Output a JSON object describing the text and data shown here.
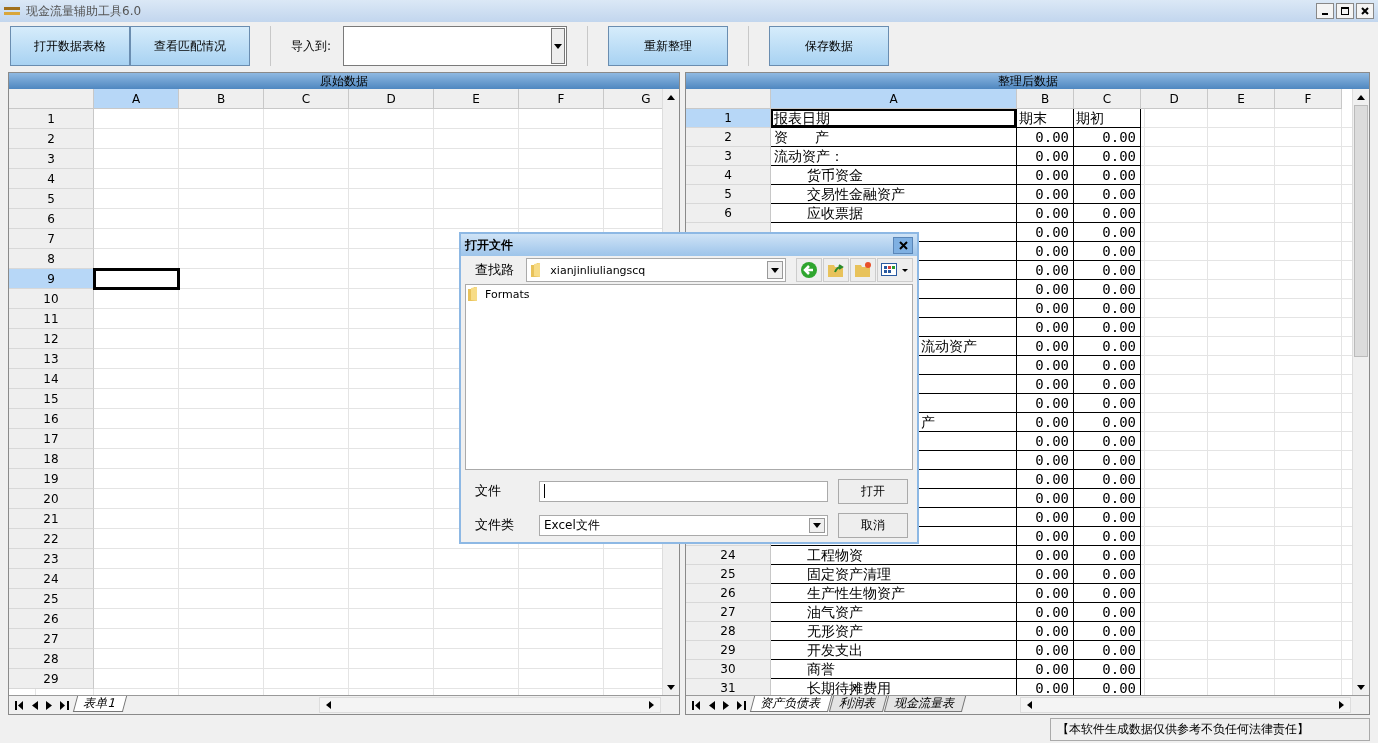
{
  "window": {
    "title": "现金流量辅助工具6.0"
  },
  "toolbar": {
    "open_button": "打开数据表格",
    "match_button": "查看匹配情况",
    "import_label": "导入到:",
    "reorganize_button": "重新整理",
    "save_button": "保存数据"
  },
  "source_panel": {
    "title": "原始数据",
    "columns": [
      {
        "label": "A",
        "selected": true
      },
      {
        "label": "B",
        "selected": false
      },
      {
        "label": "C",
        "selected": false
      },
      {
        "label": "D",
        "selected": false
      },
      {
        "label": "E",
        "selected": false
      },
      {
        "label": "F",
        "selected": false
      },
      {
        "label": "G",
        "selected": false
      }
    ],
    "rows": [
      {
        "number": "1",
        "selected": false
      },
      {
        "number": "2",
        "selected": false
      },
      {
        "number": "3",
        "selected": false
      },
      {
        "number": "4",
        "selected": false
      },
      {
        "number": "5",
        "selected": false
      },
      {
        "number": "6",
        "selected": false
      },
      {
        "number": "7",
        "selected": false
      },
      {
        "number": "8",
        "selected": false
      },
      {
        "number": "9",
        "selected": true
      },
      {
        "number": "10",
        "selected": false
      },
      {
        "number": "11",
        "selected": false
      },
      {
        "number": "12",
        "selected": false
      },
      {
        "number": "13",
        "selected": false
      },
      {
        "number": "14",
        "selected": false
      },
      {
        "number": "15",
        "selected": false
      },
      {
        "number": "16",
        "selected": false
      },
      {
        "number": "17",
        "selected": false
      },
      {
        "number": "18",
        "selected": false
      },
      {
        "number": "19",
        "selected": false
      },
      {
        "number": "20",
        "selected": false
      },
      {
        "number": "21",
        "selected": false
      },
      {
        "number": "22",
        "selected": false
      },
      {
        "number": "23",
        "selected": false
      },
      {
        "number": "24",
        "selected": false
      },
      {
        "number": "25",
        "selected": false
      },
      {
        "number": "26",
        "selected": false
      },
      {
        "number": "27",
        "selected": false
      },
      {
        "number": "28",
        "selected": false
      },
      {
        "number": "29",
        "selected": false
      }
    ],
    "sheet_tabs": [
      {
        "label": "表单1",
        "selected": true
      }
    ]
  },
  "result_panel": {
    "title": "整理后数据",
    "columns": [
      {
        "label": "A",
        "selected": true
      },
      {
        "label": "B",
        "selected": false
      },
      {
        "label": "C",
        "selected": false
      },
      {
        "label": "D",
        "selected": false
      },
      {
        "label": "E",
        "selected": false
      },
      {
        "label": "F",
        "selected": false
      }
    ],
    "rows": [
      {
        "number": "1",
        "selected": true,
        "kind": "header",
        "label": "报表日期",
        "b": "期末",
        "c": "期初"
      },
      {
        "number": "2",
        "selected": false,
        "kind": "heading",
        "label": "资      产",
        "b": "0.00",
        "c": "0.00"
      },
      {
        "number": "3",
        "selected": false,
        "kind": "heading",
        "label": "流动资产：",
        "b": "0.00",
        "c": "0.00"
      },
      {
        "number": "4",
        "selected": false,
        "kind": "item",
        "label": "货币资金",
        "b": "0.00",
        "c": "0.00"
      },
      {
        "number": "5",
        "selected": false,
        "kind": "item",
        "label": "交易性金融资产",
        "b": "0.00",
        "c": "0.00"
      },
      {
        "number": "6",
        "selected": false,
        "kind": "item",
        "label": "应收票据",
        "b": "0.00",
        "c": "0.00"
      },
      {
        "kind": "partial",
        "b": "0.00",
        "c": "0.00"
      },
      {
        "kind": "hidden",
        "b": "0.00",
        "c": "0.00"
      },
      {
        "kind": "hidden",
        "b": "0.00",
        "c": "0.00"
      },
      {
        "kind": "hidden",
        "b": "0.00",
        "c": "0.00"
      },
      {
        "kind": "hidden",
        "b": "0.00",
        "c": "0.00"
      },
      {
        "kind": "hidden",
        "b": "0.00",
        "c": "0.00"
      },
      {
        "kind": "fragment",
        "label": "流动资产",
        "b": "0.00",
        "c": "0.00"
      },
      {
        "kind": "hidden",
        "b": "0.00",
        "c": "0.00"
      },
      {
        "kind": "hidden",
        "b": "0.00",
        "c": "0.00"
      },
      {
        "kind": "hidden",
        "b": "0.00",
        "c": "0.00"
      },
      {
        "kind": "fragment",
        "label": "产",
        "b": "0.00",
        "c": "0.00"
      },
      {
        "kind": "hidden",
        "b": "0.00",
        "c": "0.00"
      },
      {
        "kind": "hidden",
        "b": "0.00",
        "c": "0.00"
      },
      {
        "kind": "hidden",
        "b": "0.00",
        "c": "0.00"
      },
      {
        "kind": "hidden",
        "b": "0.00",
        "c": "0.00"
      },
      {
        "kind": "hidden",
        "b": "0.00",
        "c": "0.00"
      },
      {
        "kind": "hidden",
        "b": "0.00",
        "c": "0.00"
      },
      {
        "number": "24",
        "selected": false,
        "kind": "item",
        "label": "工程物资",
        "b": "0.00",
        "c": "0.00"
      },
      {
        "number": "25",
        "selected": false,
        "kind": "item",
        "label": "固定资产清理",
        "b": "0.00",
        "c": "0.00"
      },
      {
        "number": "26",
        "selected": false,
        "kind": "item",
        "label": "生产性生物资产",
        "b": "0.00",
        "c": "0.00"
      },
      {
        "number": "27",
        "selected": false,
        "kind": "item",
        "label": "油气资产",
        "b": "0.00",
        "c": "0.00"
      },
      {
        "number": "28",
        "selected": false,
        "kind": "item",
        "label": "无形资产",
        "b": "0.00",
        "c": "0.00"
      },
      {
        "number": "29",
        "selected": false,
        "kind": "item",
        "label": "开发支出",
        "b": "0.00",
        "c": "0.00"
      },
      {
        "number": "30",
        "selected": false,
        "kind": "item",
        "label": "商誉",
        "b": "0.00",
        "c": "0.00"
      },
      {
        "number": "31",
        "selected": false,
        "kind": "item",
        "label": "长期待摊费用",
        "b": "0.00",
        "c": "0.00"
      }
    ],
    "sheet_tabs": [
      {
        "label": "资产负债表",
        "selected": true
      },
      {
        "label": "利润表",
        "selected": false
      },
      {
        "label": "现金流量表",
        "selected": false
      }
    ]
  },
  "status_bar": {
    "notice": "【本软件生成数据仅供参考不负任何法律责任】"
  },
  "dialog": {
    "title": "打开文件",
    "look_in_label": "查找路",
    "look_in_value": "xianjinliuliangscq",
    "files": [
      {
        "name": "Formats"
      }
    ],
    "filename_label": "文件",
    "filetype_label": "文件类",
    "filetype_value": "Excel文件",
    "open_button": "打开",
    "cancel_button": "取消"
  }
}
